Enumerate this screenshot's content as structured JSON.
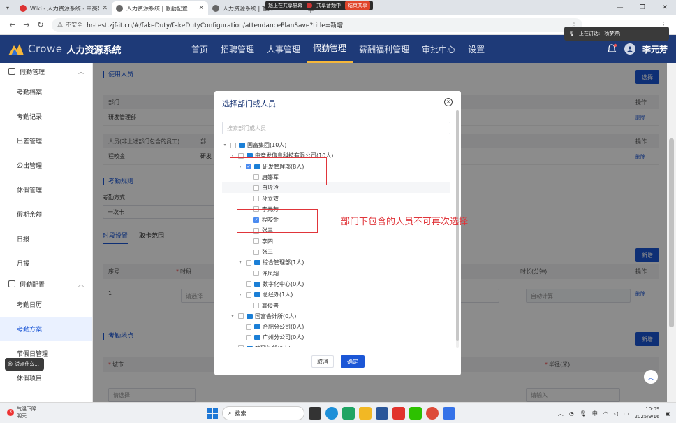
{
  "browser": {
    "tabs": [
      {
        "title": "Wiki - 人力资源系统 - 中亮发...",
        "active": false,
        "color": "#d33"
      },
      {
        "title": "人力资源系统 | 假勤配置",
        "active": true,
        "color": "#666"
      },
      {
        "title": "人力资源系统 | 首页",
        "active": false,
        "color": "#666"
      }
    ],
    "insecure_label": "不安全",
    "url": "hr-test.zjf-it.cn/#/fakeDuty/fakeDutyConfiguration/attendancePlanSave?title=新增"
  },
  "share_bar": {
    "sharing_text": "您正在共享屏幕",
    "audio_text": "共享音频中",
    "stop_label": "结束共享"
  },
  "speak_toast": {
    "speaking_label": "正在讲话:",
    "speaker": "杨梦婷;"
  },
  "app": {
    "logo_text": "Crowe",
    "logo_sub": "人力资源系统",
    "nav": [
      "首页",
      "招聘管理",
      "人事管理",
      "假勤管理",
      "薪酬福利管理",
      "审批中心",
      "设置"
    ],
    "active_nav": "假勤管理",
    "username": "李元芳"
  },
  "sidebar": {
    "group1": "假勤管理",
    "group1_items": [
      "考勤档案",
      "考勤记录",
      "出差管理",
      "公出管理",
      "休假管理",
      "假期余额",
      "日报",
      "月报"
    ],
    "group2": "假勤配置",
    "group2_items": [
      "考勤日历",
      "考勤方案",
      "节假日管理",
      "休假项目"
    ],
    "active_item": "考勤方案"
  },
  "main": {
    "section_users": "使用人员",
    "select_button": "选择",
    "dept_table": {
      "headers": [
        "部门",
        "操作"
      ],
      "row": "研发管理部",
      "delete": "删除"
    },
    "person_table": {
      "headers": [
        "人员(非上述部门包含的员工)",
        "部",
        "操作"
      ],
      "row": "程咬金",
      "row_dept": "研发",
      "delete": "删除"
    },
    "section_rules": "考勤规则",
    "method_label": "考勤方式",
    "method_value": "一次卡",
    "subtabs": [
      "时段设置",
      "取卡范围"
    ],
    "add_button": "新增",
    "period_table": {
      "headers": [
        "序号",
        "时段",
        "时长(分钟)",
        "操作"
      ],
      "row_index": "1",
      "select_placeholder": "请选择",
      "auto_calc": "自动计算",
      "delete": "删除"
    },
    "section_location": "考勤地点",
    "city_label": "城市",
    "radius_label": "半径(米)",
    "city_placeholder": "请选择",
    "radius_placeholder": "请输入"
  },
  "dialog": {
    "title": "选择部门或人员",
    "search_placeholder": "搜索部门或人员",
    "cancel": "取消",
    "ok": "确定",
    "tree": [
      {
        "label": "国富集团(10人)",
        "level": 0,
        "folder": true,
        "arrow": "▾",
        "checked": false
      },
      {
        "label": "中竞发信息科技有限公司(10人)",
        "level": 1,
        "folder": true,
        "arrow": "▾",
        "checked": false
      },
      {
        "label": "研发管理部(8人)",
        "level": 2,
        "folder": true,
        "arrow": "▾",
        "checked": true
      },
      {
        "label": "唐娜军",
        "level": 3,
        "folder": false,
        "arrow": "",
        "checked": false
      },
      {
        "label": "白玲玲",
        "level": 3,
        "folder": false,
        "arrow": "",
        "checked": false
      },
      {
        "label": "孙立双",
        "level": 3,
        "folder": false,
        "arrow": "",
        "checked": false
      },
      {
        "label": "李元芳",
        "level": 3,
        "folder": false,
        "arrow": "",
        "checked": false
      },
      {
        "label": "程咬金",
        "level": 3,
        "folder": false,
        "arrow": "",
        "checked": true
      },
      {
        "label": "张三",
        "level": 3,
        "folder": false,
        "arrow": "",
        "checked": false
      },
      {
        "label": "李四",
        "level": 3,
        "folder": false,
        "arrow": "",
        "checked": false
      },
      {
        "label": "张三",
        "level": 3,
        "folder": false,
        "arrow": "",
        "checked": false
      },
      {
        "label": "综合管理部(1人)",
        "level": 2,
        "folder": true,
        "arrow": "▾",
        "checked": false
      },
      {
        "label": "许凤翔",
        "level": 3,
        "folder": false,
        "arrow": "",
        "checked": false
      },
      {
        "label": "数字化中心(0人)",
        "level": 2,
        "folder": true,
        "arrow": "",
        "checked": false
      },
      {
        "label": "总经办(1人)",
        "level": 2,
        "folder": true,
        "arrow": "▾",
        "checked": false
      },
      {
        "label": "高俊普",
        "level": 3,
        "folder": false,
        "arrow": "",
        "checked": false
      },
      {
        "label": "国富会计所(0人)",
        "level": 1,
        "folder": true,
        "arrow": "▾",
        "checked": false
      },
      {
        "label": "合肥分公司(0人)",
        "level": 2,
        "folder": true,
        "arrow": "",
        "checked": false
      },
      {
        "label": "广州分公司(0人)",
        "level": 2,
        "folder": true,
        "arrow": "",
        "checked": false
      },
      {
        "label": "管理总部(0人)",
        "level": 1,
        "folder": true,
        "arrow": "",
        "checked": false
      }
    ]
  },
  "annotation": "部门下包含的人员不可再次选择",
  "feedback_label": "说点什么...",
  "taskbar": {
    "weather_title": "气温下降",
    "weather_sub": "明天",
    "weather_badge": "3",
    "search_label": "搜索",
    "ime": "中",
    "time": "10:09",
    "date": "2025/9/16"
  }
}
